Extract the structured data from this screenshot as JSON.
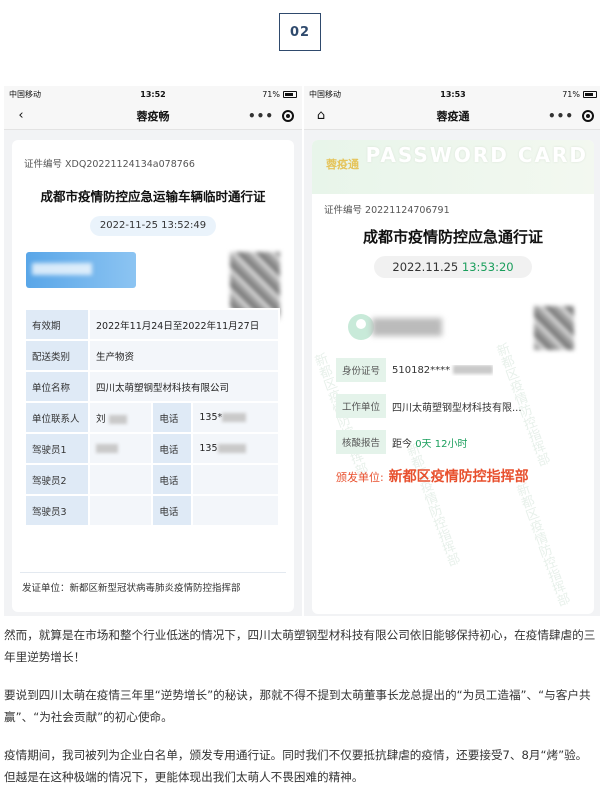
{
  "section_number": "02",
  "left_phone": {
    "status": {
      "carrier": "中国移动",
      "time": "13:52",
      "battery": "71%"
    },
    "nav_title": "蓉疫畅",
    "cert_no": "证件编号 XDQ20221124134a078766",
    "title": "成都市疫情防控应急运输车辆临时通行证",
    "datetime": "2022-11-25 13:52:49",
    "rows": [
      {
        "label": "有效期",
        "value": "2022年11月24日至2022年11月27日"
      },
      {
        "label": "配送类别",
        "value": "生产物资"
      },
      {
        "label": "单位名称",
        "value": "四川太萌塑钢型材科技有限公司"
      },
      {
        "label": "单位联系人",
        "value": "刘",
        "label2": "电话",
        "value2": "135*"
      },
      {
        "label": "驾驶员1",
        "value": "",
        "label2": "电话",
        "value2": "135"
      },
      {
        "label": "驾驶员2",
        "value": "",
        "label2": "电话",
        "value2": ""
      },
      {
        "label": "驾驶员3",
        "value": "",
        "label2": "电话",
        "value2": ""
      }
    ],
    "issuer": "发证单位：新都区新型冠状病毒肺炎疫情防控指挥部"
  },
  "right_phone": {
    "status": {
      "carrier": "中国移动",
      "time": "13:53",
      "battery": "71%"
    },
    "nav_title": "蓉疫通",
    "tag": "蓉疫通",
    "card_brand": "PASSWORD CARD",
    "cert_no": "证件编号 20221124706791",
    "title": "成都市疫情防控应急通行证",
    "date": "2022.11.25",
    "time": "13:53:20",
    "id_label": "身份证号",
    "id_value": "510182****",
    "work_label": "工作单位",
    "work_value": "四川太萌塑钢型材科技有限...",
    "test_label": "核酸报告",
    "test_prefix": "距今",
    "test_days": "0天",
    "test_hours": "12小时",
    "issuer_label": "颁发单位:",
    "issuer_value": "新都区疫情防控指挥部",
    "watermark": "新都区疫情防控指挥部"
  },
  "paragraphs": [
    "然而，就算是在市场和整个行业低迷的情况下，四川太萌塑钢型材科技有限公司依旧能够保持初心，在疫情肆虐的三年里逆势增长！",
    "要说到四川太萌在疫情三年里“逆势增长”的秘诀，那就不得不提到太萌董事长龙总提出的“为员工造福”、“与客户共赢”、“为社会贡献”的初心使命。",
    "疫情期间，我司被列为企业白名单，颁发专用通行证。同时我们不仅要抵抗肆虐的疫情，还要接受7、8月“烤”验。但越是在这种极端的情况下，更能体现出我们太萌人不畏困难的精神。"
  ]
}
